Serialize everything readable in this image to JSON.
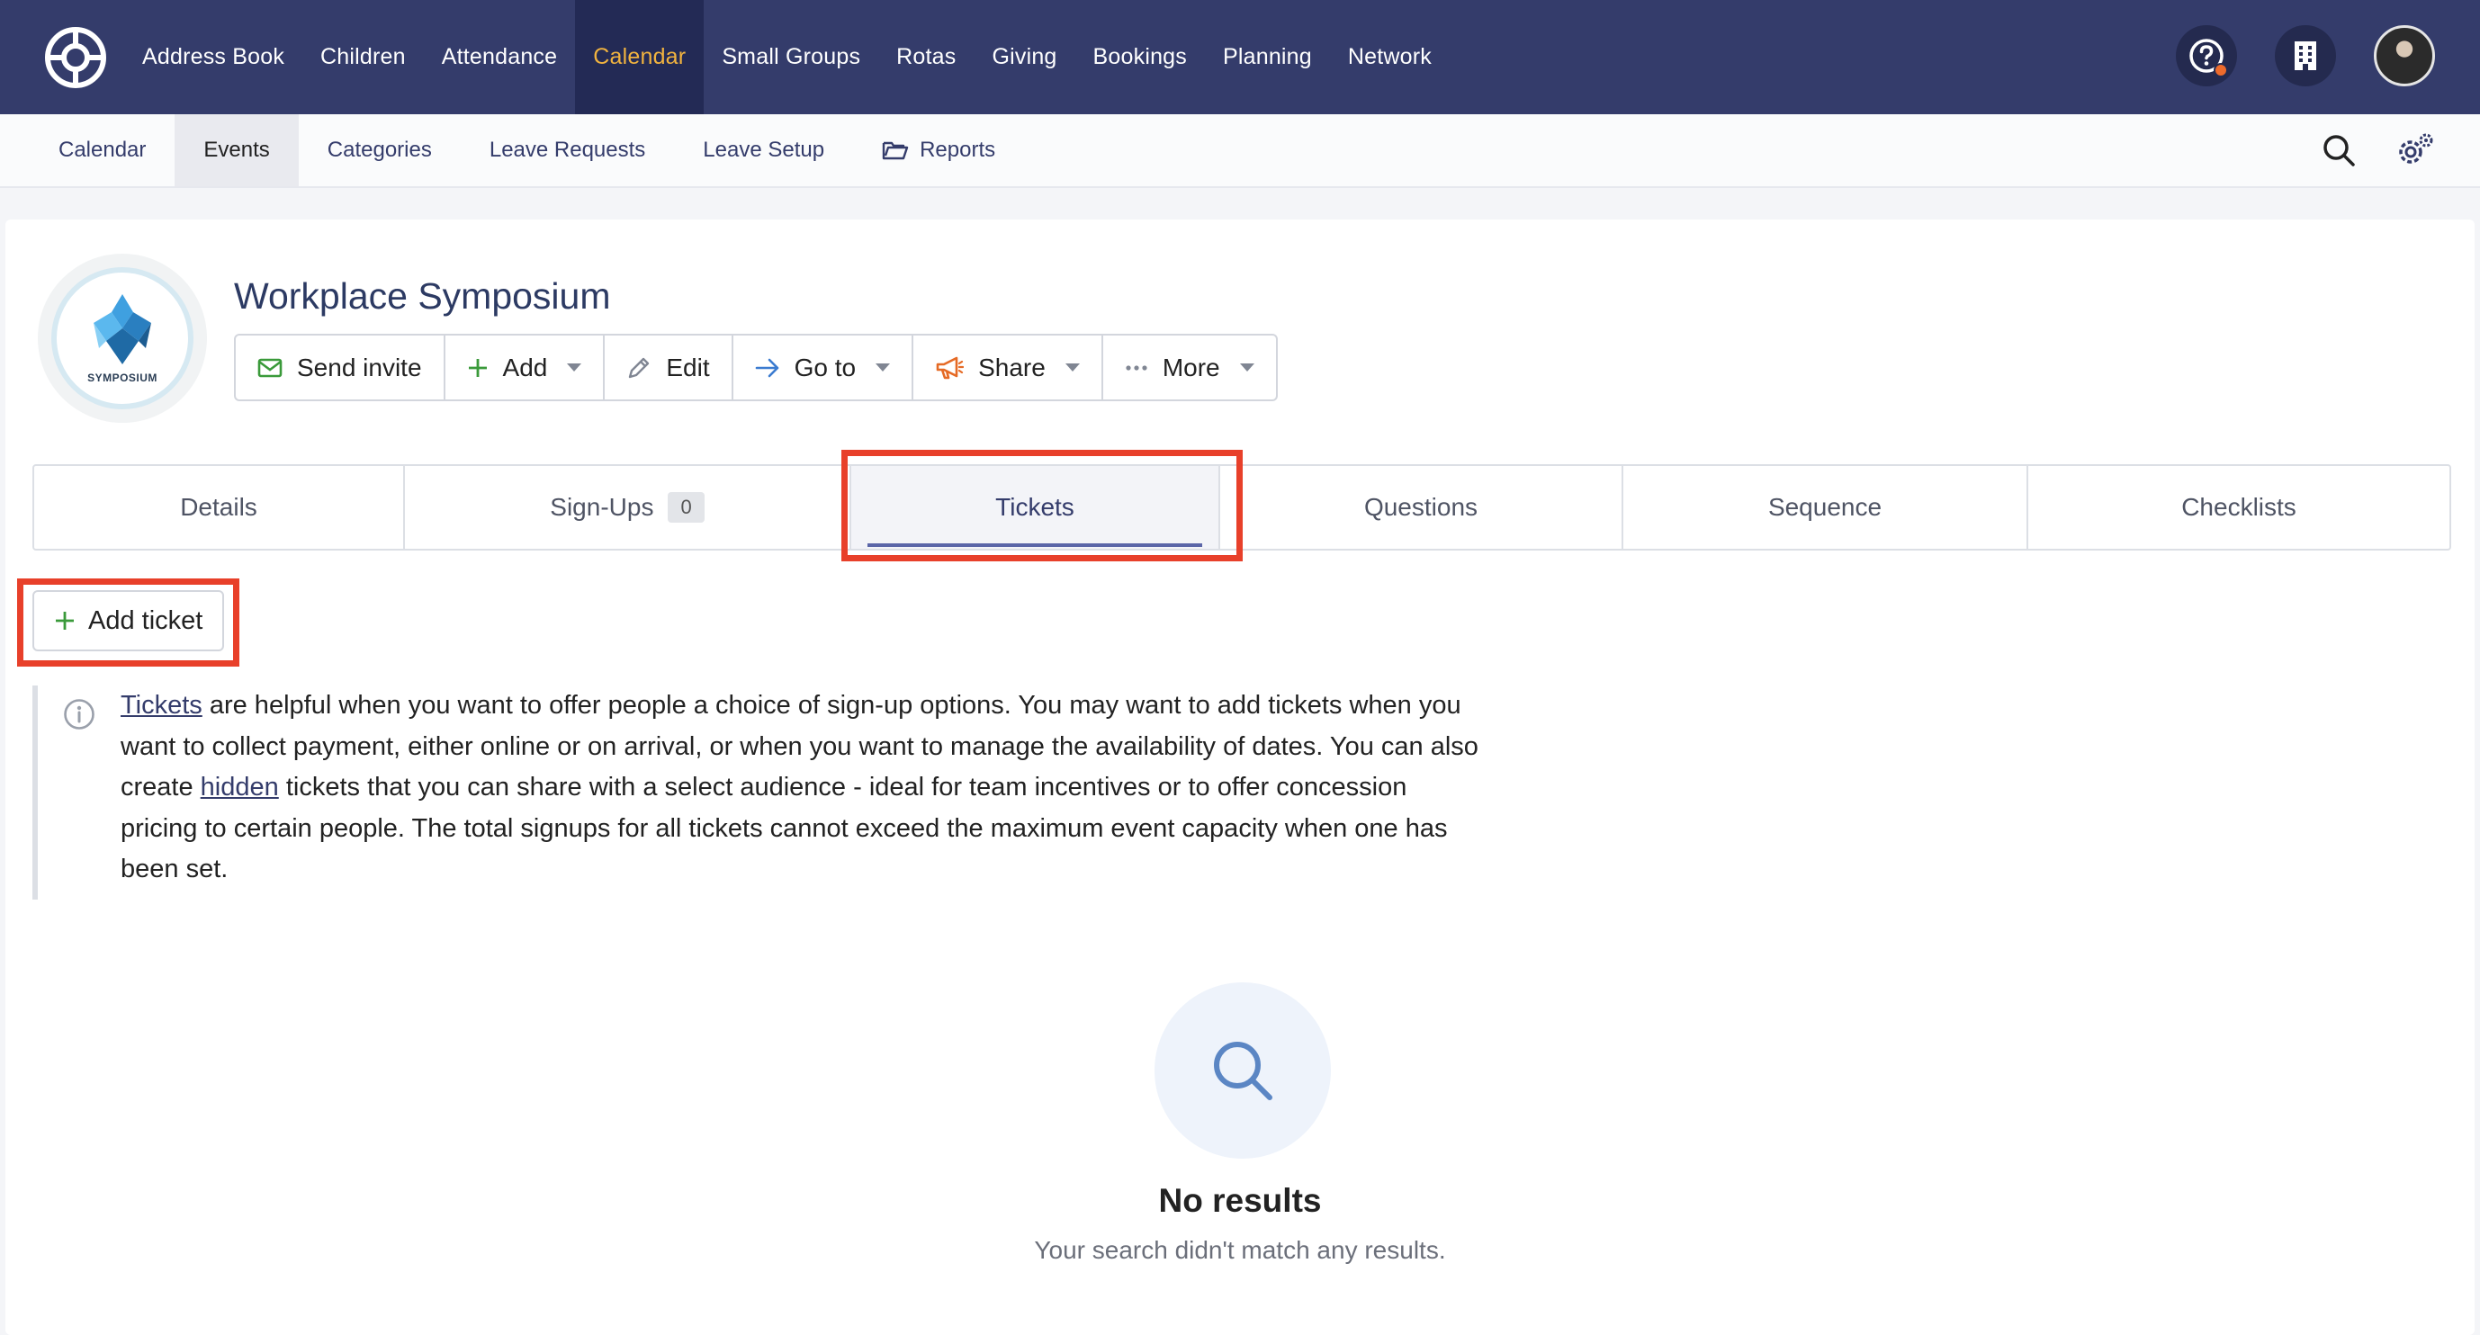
{
  "topnav": {
    "items": [
      {
        "label": "Address Book"
      },
      {
        "label": "Children"
      },
      {
        "label": "Attendance"
      },
      {
        "label": "Calendar",
        "active": true
      },
      {
        "label": "Small Groups"
      },
      {
        "label": "Rotas"
      },
      {
        "label": "Giving"
      },
      {
        "label": "Bookings"
      },
      {
        "label": "Planning"
      },
      {
        "label": "Network"
      }
    ]
  },
  "subnav": {
    "items": [
      {
        "label": "Calendar"
      },
      {
        "label": "Events",
        "active": true
      },
      {
        "label": "Categories"
      },
      {
        "label": "Leave Requests"
      },
      {
        "label": "Leave Setup"
      },
      {
        "label": "Reports",
        "icon": "folder-icon"
      }
    ]
  },
  "event": {
    "title": "Workplace Symposium",
    "logo_text": "SYMPOSIUM"
  },
  "actions": {
    "send_invite": "Send invite",
    "add": "Add",
    "edit": "Edit",
    "go_to": "Go to",
    "share": "Share",
    "more": "More"
  },
  "tabs": {
    "details": "Details",
    "signups": "Sign-Ups",
    "signups_count": "0",
    "tickets": "Tickets",
    "questions": "Questions",
    "sequence": "Sequence",
    "checklists": "Checklists"
  },
  "add_ticket": "Add ticket",
  "info": {
    "link_tickets": "Tickets",
    "part1": " are helpful when you want to offer people a choice of sign-up options. You may want to add tickets when you want to collect payment, either online or on arrival, or when you want to manage the availability of dates. You can also create ",
    "link_hidden": "hidden",
    "part2": " tickets that you can share with a select audience - ideal for team incentives or to offer concession pricing to certain people. The total signups for all tickets cannot exceed the maximum event capacity when one has been set."
  },
  "empty": {
    "title": "No results",
    "subtitle": "Your search didn't match any results."
  },
  "colors": {
    "nav_bg": "#343c6b",
    "nav_active_bg": "#232a55",
    "nav_active_text": "#f1b33f",
    "highlight": "#e8402a",
    "plus_green": "#3a9a3a"
  }
}
